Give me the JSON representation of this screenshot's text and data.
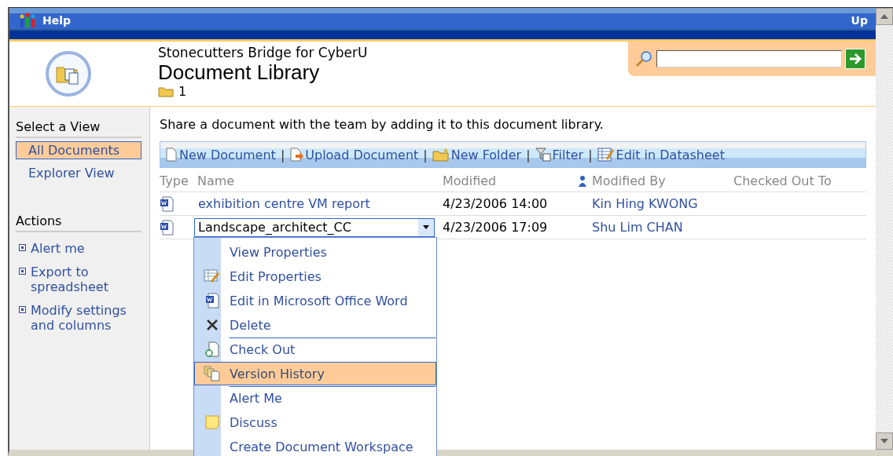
{
  "title_bar": {
    "help": "Help",
    "up": "Up"
  },
  "header": {
    "site": "Stonecutters Bridge for CyberU",
    "title": "Document Library",
    "folder_count": "1"
  },
  "sidebar": {
    "views_heading": "Select a View",
    "views": [
      {
        "label": "All Documents",
        "selected": true
      },
      {
        "label": "Explorer View",
        "selected": false
      }
    ],
    "actions_heading": "Actions",
    "actions": [
      "Alert me",
      "Export to spreadsheet",
      "Modify settings and columns"
    ]
  },
  "description": "Share a document with the team by adding it to this document library.",
  "toolbar": [
    {
      "kind": "new",
      "label": "New Document"
    },
    {
      "kind": "separator",
      "label": "|"
    },
    {
      "kind": "upload",
      "label": "Upload Document"
    },
    {
      "kind": "separator",
      "label": "|"
    },
    {
      "kind": "folder",
      "label": "New Folder"
    },
    {
      "kind": "separator",
      "label": "|"
    },
    {
      "kind": "filter",
      "label": "Filter"
    },
    {
      "kind": "separator",
      "label": "|"
    },
    {
      "kind": "datasheet",
      "label": "Edit in Datasheet"
    }
  ],
  "table": {
    "columns": [
      "Type",
      "Name",
      "Modified",
      "Modified By",
      "Checked Out To"
    ],
    "rows": [
      {
        "name": "exhibition centre VM report",
        "modified": "4/23/2006 14:00",
        "modified_by": "Kin Hing KWONG",
        "selected": false
      },
      {
        "name": "Landscape_architect_CC",
        "modified": "4/23/2006 17:09",
        "modified_by": "Shu Lim CHAN",
        "selected": true
      }
    ]
  },
  "context_menu": [
    {
      "kind": "none",
      "label": "View Properties",
      "separator_above": false,
      "selected": false
    },
    {
      "kind": "edit",
      "label": "Edit Properties",
      "separator_above": false,
      "selected": false
    },
    {
      "kind": "word",
      "label": "Edit in Microsoft Office Word",
      "separator_above": false,
      "selected": false
    },
    {
      "kind": "delete",
      "label": "Delete",
      "separator_above": false,
      "selected": false
    },
    {
      "kind": "checkout",
      "label": "Check Out",
      "separator_above": true,
      "selected": false
    },
    {
      "kind": "versions",
      "label": "Version History",
      "separator_above": false,
      "selected": true
    },
    {
      "kind": "none",
      "label": "Alert Me",
      "separator_above": true,
      "selected": false
    },
    {
      "kind": "discuss",
      "label": "Discuss",
      "separator_above": false,
      "selected": false
    },
    {
      "kind": "none",
      "label": "Create Document Workspace",
      "separator_above": false,
      "selected": false
    }
  ]
}
